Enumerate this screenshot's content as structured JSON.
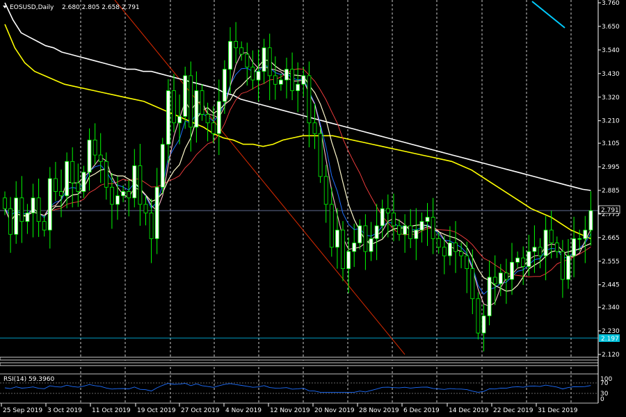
{
  "header": {
    "symbol": "EOSUSD,Daily",
    "ohlc": "2.680 2.805 2.658 2.791"
  },
  "indicator": {
    "label": "RSI(14) 59.3960",
    "levels": [
      "100",
      "70",
      "30",
      "0"
    ]
  },
  "price_labels": {
    "current": "2.791",
    "level": "2.197"
  },
  "colors": {
    "background": "#000000",
    "bull_candle": "#ffffff",
    "bear_candle": "#000000",
    "wick": "#00ff00",
    "sma200": "#ffffff",
    "sma100": "#ffff00",
    "sma5": "#ffc0cb",
    "ema10": "#1e6fff",
    "ema20": "#fffacd",
    "sma50": "#ff4040",
    "diag_line": "#dd2a00",
    "cyan_line": "#00ccff",
    "rsi": "#1e6fff"
  },
  "chart_data": {
    "type": "candlestick",
    "title": "EOSUSD,Daily",
    "y_ticks": [
      "3.760",
      "3.650",
      "3.540",
      "3.430",
      "3.320",
      "3.210",
      "3.105",
      "2.995",
      "2.885",
      "2.775",
      "2.665",
      "2.555",
      "2.445",
      "2.340",
      "2.230",
      "2.120"
    ],
    "ylim": [
      2.12,
      3.76
    ],
    "x_ticks": [
      "25 Sep 2019",
      "3 Oct 2019",
      "11 Oct 2019",
      "19 Oct 2019",
      "27 Oct 2019",
      "4 Nov 2019",
      "12 Nov 2019",
      "20 Nov 2019",
      "28 Nov 2019",
      "6 Dec 2019",
      "14 Dec 2019",
      "22 Dec 2019",
      "31 Dec 2019"
    ],
    "horizontal_lines": [
      2.791,
      2.197
    ],
    "closes": [
      2.8,
      2.68,
      2.85,
      2.74,
      2.78,
      2.85,
      2.74,
      2.7,
      2.94,
      2.88,
      2.86,
      3.02,
      2.92,
      2.88,
      2.97,
      3.12,
      3.05,
      3.02,
      2.9,
      2.82,
      2.86,
      2.88,
      2.85,
      3.0,
      2.82,
      2.78,
      2.66,
      2.9,
      3.1,
      3.35,
      3.2,
      3.23,
      3.42,
      3.18,
      3.35,
      3.24,
      3.2,
      3.15,
      3.3,
      3.45,
      3.58,
      3.55,
      3.52,
      3.46,
      3.4,
      3.44,
      3.55,
      3.42,
      3.38,
      3.4,
      3.45,
      3.35,
      3.38,
      3.42,
      3.2,
      3.15,
      2.95,
      2.82,
      2.62,
      2.7,
      2.52,
      2.6,
      2.64,
      2.72,
      2.6,
      2.66,
      2.72,
      2.8,
      2.78,
      2.72,
      2.68,
      2.72,
      2.66,
      2.7,
      2.74,
      2.76,
      2.66,
      2.62,
      2.58,
      2.64,
      2.6,
      2.58,
      2.52,
      2.38,
      2.22,
      2.3,
      2.48,
      2.45,
      2.5,
      2.47,
      2.55,
      2.57,
      2.53,
      2.6,
      2.62,
      2.58,
      2.7,
      2.64,
      2.6,
      2.47,
      2.58,
      2.66,
      2.66,
      2.7,
      2.791
    ],
    "series": [
      {
        "name": "",
        "values": [
          3.76,
          3.68,
          3.62,
          3.6,
          3.58,
          3.56,
          3.55,
          3.53,
          3.52,
          3.51,
          3.5,
          3.49,
          3.48,
          3.47,
          3.46,
          3.45,
          3.45,
          3.44,
          3.44,
          3.43,
          3.42,
          3.41,
          3.4,
          3.39,
          3.38,
          3.37,
          3.36,
          3.34,
          3.33,
          3.31,
          3.3,
          3.29,
          3.28,
          3.27,
          3.26,
          3.25,
          3.24,
          3.23,
          3.22,
          3.21,
          3.2,
          3.19,
          3.18,
          3.17,
          3.16,
          3.15,
          3.14,
          3.13,
          3.12,
          3.11,
          3.1,
          3.09,
          3.08,
          3.07,
          3.06,
          3.05,
          3.04,
          3.03,
          3.02,
          3.01,
          3.0,
          2.99,
          2.98,
          2.97,
          2.96,
          2.95,
          2.94,
          2.93,
          2.92,
          2.91,
          2.9,
          2.89,
          2.885
        ]
      },
      {
        "name": "",
        "values": [
          3.66,
          3.55,
          3.48,
          3.44,
          3.42,
          3.4,
          3.38,
          3.37,
          3.36,
          3.35,
          3.34,
          3.33,
          3.32,
          3.31,
          3.3,
          3.28,
          3.26,
          3.24,
          3.22,
          3.2,
          3.18,
          3.15,
          3.13,
          3.12,
          3.1,
          3.1,
          3.09,
          3.1,
          3.12,
          3.13,
          3.14,
          3.14,
          3.14,
          3.14,
          3.13,
          3.12,
          3.11,
          3.1,
          3.09,
          3.08,
          3.07,
          3.06,
          3.05,
          3.04,
          3.03,
          3.02,
          3.0,
          2.98,
          2.95,
          2.92,
          2.89,
          2.86,
          2.83,
          2.8,
          2.78,
          2.76,
          2.73,
          2.7,
          2.68,
          2.66
        ]
      }
    ],
    "rsi_levels": [
      100,
      70,
      30,
      0
    ],
    "rsi_value": 59.396
  }
}
